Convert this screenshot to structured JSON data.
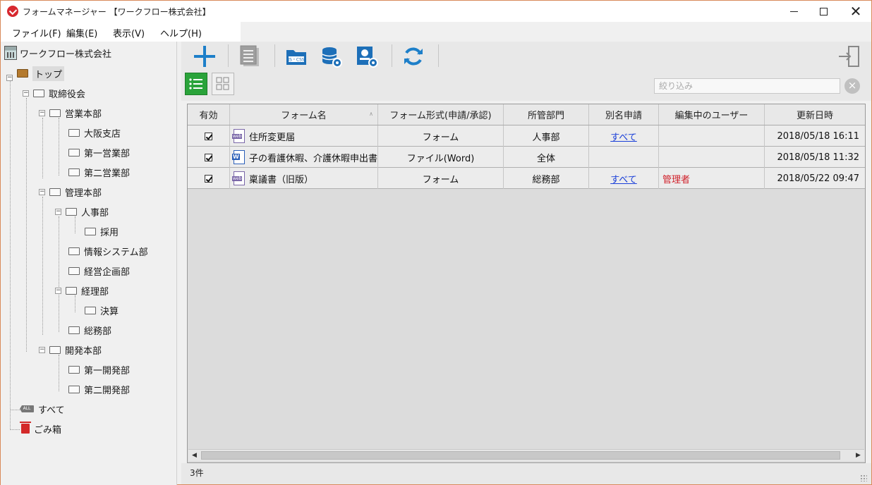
{
  "window": {
    "title": "フォームマネージャー 【ワークフロー株式会社】"
  },
  "menu": [
    {
      "label": "ファイル(F)"
    },
    {
      "label": "編集(E)"
    },
    {
      "label": "表示(V)"
    },
    {
      "label": "ヘルプ(H)"
    }
  ],
  "tree": {
    "company": "ワークフロー株式会社",
    "nodes": [
      {
        "label": "トップ",
        "icon": "folder-open-icon",
        "selected": true
      },
      {
        "label": "取締役会",
        "icon": "folder-icon"
      },
      {
        "label": "営業本部",
        "icon": "folder-icon"
      },
      {
        "label": "大阪支店",
        "icon": "folder-icon"
      },
      {
        "label": "第一営業部",
        "icon": "folder-icon"
      },
      {
        "label": "第二営業部",
        "icon": "folder-icon"
      },
      {
        "label": "管理本部",
        "icon": "folder-icon"
      },
      {
        "label": "人事部",
        "icon": "folder-icon"
      },
      {
        "label": "採用",
        "icon": "folder-icon"
      },
      {
        "label": "情報システム部",
        "icon": "folder-icon"
      },
      {
        "label": "経営企画部",
        "icon": "folder-icon"
      },
      {
        "label": "経理部",
        "icon": "folder-icon"
      },
      {
        "label": "決算",
        "icon": "folder-icon"
      },
      {
        "label": "総務部",
        "icon": "folder-icon"
      },
      {
        "label": "開発本部",
        "icon": "folder-icon"
      },
      {
        "label": "第一開発部",
        "icon": "folder-icon"
      },
      {
        "label": "第二開発部",
        "icon": "folder-icon"
      },
      {
        "label": "すべて",
        "icon": "all-icon",
        "badge": "ALL"
      },
      {
        "label": "ごみ箱",
        "icon": "trash-icon"
      }
    ]
  },
  "toolbar": {
    "icons": [
      "add-icon",
      "document-list-icon",
      "js-css-folder-icon",
      "database-settings-icon",
      "user-settings-icon",
      "refresh-icon",
      "exit-icon"
    ],
    "js_css_badge": "JS・CSS"
  },
  "view": {
    "filter_placeholder": "絞り込み",
    "clear_symbol": "×"
  },
  "grid": {
    "columns": [
      "有効",
      "フォーム名",
      "フォーム形式(申請/承認)",
      "所管部門",
      "別名申請",
      "編集中のユーザー",
      "更新日時"
    ],
    "sort_indicator": "∧",
    "rows": [
      {
        "enabled": true,
        "icon": "web-form-icon",
        "name": "住所変更届",
        "type": "フォーム",
        "dept": "人事部",
        "alias": "すべて",
        "editing_user": "",
        "updated": "2018/05/18 16:11"
      },
      {
        "enabled": true,
        "icon": "word-file-icon",
        "name": "子の看護休暇、介護休暇申出書",
        "type": "ファイル(Word)",
        "dept": "全体",
        "alias": "",
        "editing_user": "",
        "updated": "2018/05/18 11:32"
      },
      {
        "enabled": true,
        "icon": "web-form-icon",
        "name": "稟議書（旧版）",
        "type": "フォーム",
        "dept": "総務部",
        "alias": "すべて",
        "editing_user": "管理者",
        "updated": "2018/05/22 09:47"
      }
    ]
  },
  "status": {
    "count": "3件"
  },
  "colors": {
    "accent_blue": "#1d7fc9",
    "list_view_green": "#2aa33a",
    "link_blue": "#1a3fd8",
    "editing_red": "#d0202a",
    "app_red": "#d7282f"
  }
}
